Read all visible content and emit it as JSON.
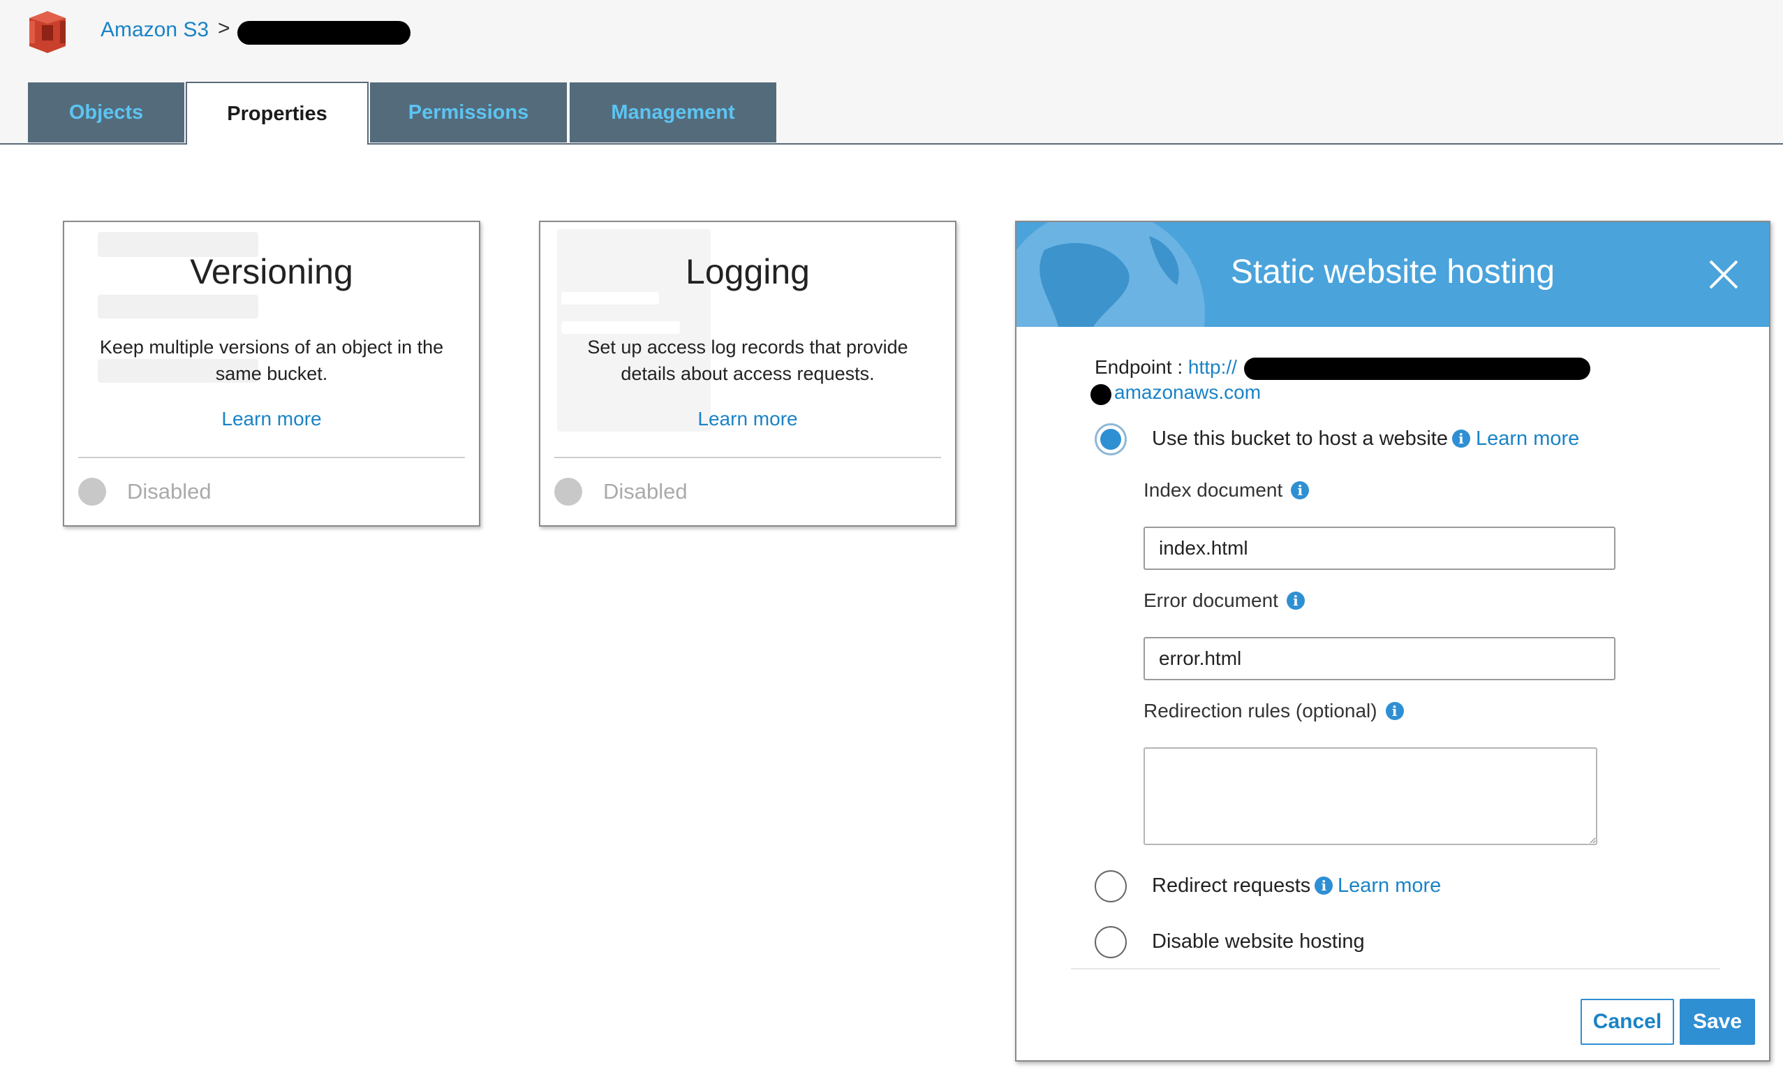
{
  "breadcrumb": {
    "root": "Amazon S3",
    "separator": ">"
  },
  "tabs": [
    {
      "label": "Objects"
    },
    {
      "label": "Properties"
    },
    {
      "label": "Permissions"
    },
    {
      "label": "Management"
    }
  ],
  "active_tab": "Properties",
  "cards": [
    {
      "title": "Versioning",
      "description": "Keep multiple versions of an object in the same bucket.",
      "learn_more": "Learn more",
      "status": "Disabled"
    },
    {
      "title": "Logging",
      "description": "Set up access log records that provide details about access requests.",
      "learn_more": "Learn more",
      "status": "Disabled"
    }
  ],
  "panel": {
    "title": "Static website hosting",
    "endpoint_label": "Endpoint : ",
    "endpoint_prefix": "http://",
    "endpoint_suffix": "amazonaws.com",
    "options": [
      {
        "label": "Use this bucket to host a website",
        "learn_more": "Learn more",
        "selected": true
      },
      {
        "label": "Redirect requests",
        "learn_more": "Learn more",
        "selected": false
      },
      {
        "label": "Disable website hosting",
        "selected": false
      }
    ],
    "index_label": "Index document",
    "index_value": "index.html",
    "error_label": "Error document",
    "error_value": "error.html",
    "redirect_rules_label": "Redirection rules (optional)",
    "redirect_rules_value": "",
    "cancel": "Cancel",
    "save": "Save"
  },
  "colors": {
    "accent": "#2f8fd3",
    "link": "#1a83c6",
    "tab_bg": "#546b7b",
    "tab_text": "#5cc4f2",
    "panel_header": "#4aa3db"
  },
  "icons": {
    "logo": "amazon-s3-logo",
    "close": "close-icon",
    "info": "info-icon"
  }
}
